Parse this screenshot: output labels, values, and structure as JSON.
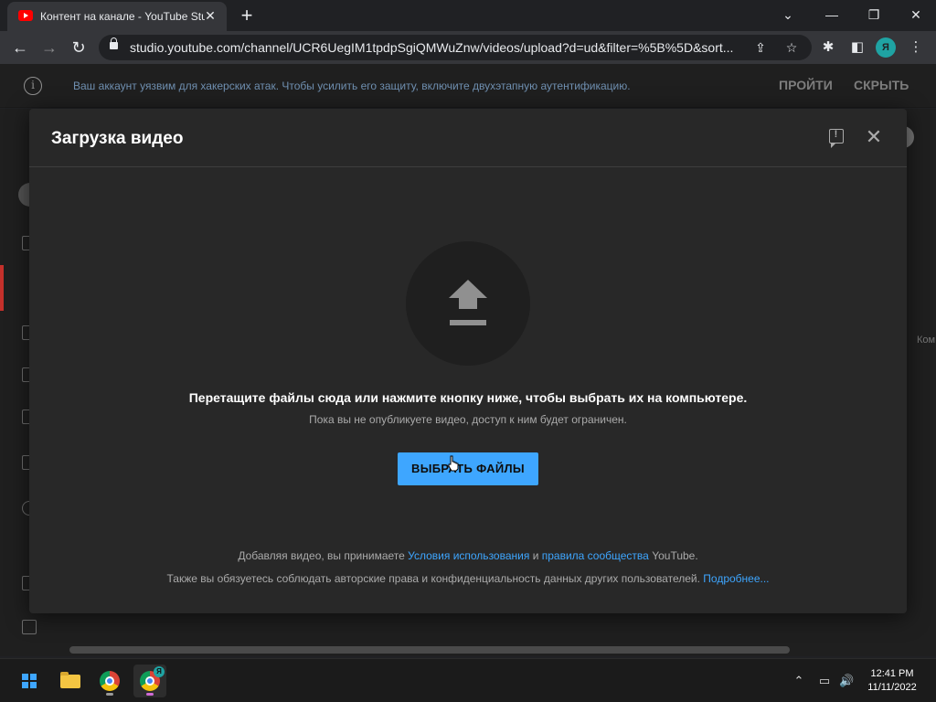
{
  "browser": {
    "tab_title": "Контент на канале - YouTube Studio",
    "tab_close": "✕",
    "new_tab": "+",
    "url": "studio.youtube.com/channel/UCR6UegIM1tpdpSgiQMWuZnw/videos/upload?d=ud&filter=%5B%5D&sort...",
    "profile_initial": "Я",
    "window_controls": {
      "minimize": "—",
      "restore": "❐",
      "close": "✕",
      "dropdown": "⌄"
    }
  },
  "banner": {
    "text": "Ваш аккаунт уязвим для хакерских атак. Чтобы усилить его защиту, включите двухэтапную аутентификацию.",
    "action_primary": "ПРОЙТИ",
    "action_secondary": "СКРЫТЬ"
  },
  "background": {
    "partial_text": "Ком"
  },
  "modal": {
    "title": "Загрузка видео",
    "drop_main": "Перетащите файлы сюда или нажмите кнопку ниже, чтобы выбрать их на компьютере.",
    "drop_sub": "Пока вы не опубликуете видео, доступ к ним будет ограничен.",
    "select_button": "ВЫБРАТЬ ФАЙЛЫ",
    "terms": {
      "prefix": "Добавляя видео, вы принимаете ",
      "link_terms": "Условия использования",
      "middle": " и ",
      "link_guidelines": "правила сообщества",
      "suffix": " YouTube."
    },
    "terms2": {
      "text": "Также вы обязуетесь соблюдать авторские права и конфиденциальность данных других пользователей. ",
      "link_more": "Подробнее..."
    }
  },
  "taskbar": {
    "time": "12:41 PM",
    "date": "11/11/2022",
    "chrome_badge": "Я"
  },
  "colors": {
    "accent": "#3ea6ff",
    "modal_bg": "#282828",
    "page_bg": "#1f1f1f"
  }
}
